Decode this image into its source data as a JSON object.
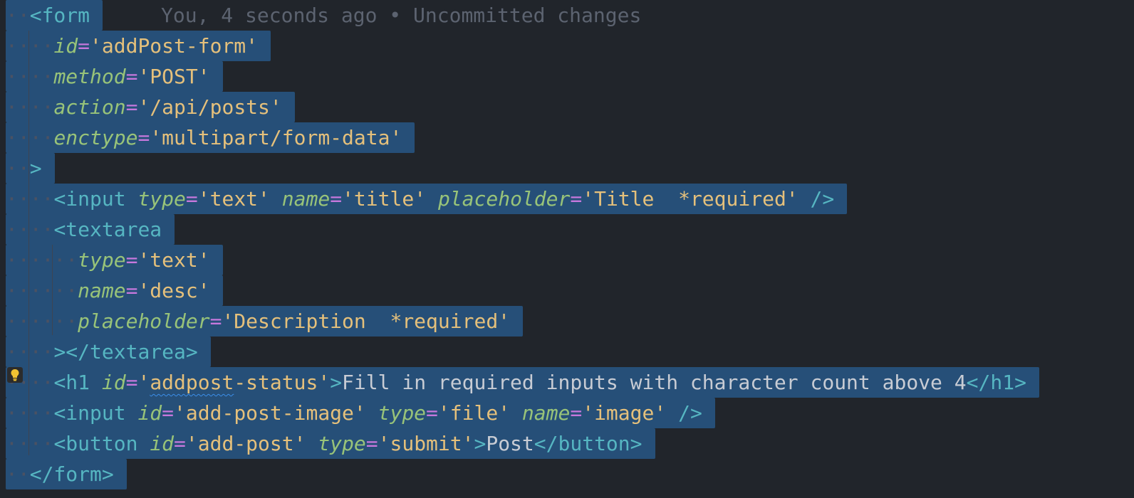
{
  "blame": "You, 4 seconds ago • Uncommitted changes",
  "lines": [
    {
      "tokens": [
        [
          "dots",
          "··"
        ],
        [
          "tag",
          "<form"
        ]
      ]
    },
    {
      "tokens": [
        [
          "dots",
          "····"
        ],
        [
          "attr",
          "id"
        ],
        [
          "eq",
          "="
        ],
        [
          "str",
          "'addPost-form'"
        ]
      ]
    },
    {
      "tokens": [
        [
          "dots",
          "····"
        ],
        [
          "attr",
          "method"
        ],
        [
          "eq",
          "="
        ],
        [
          "str",
          "'POST'"
        ]
      ]
    },
    {
      "tokens": [
        [
          "dots",
          "····"
        ],
        [
          "attr",
          "action"
        ],
        [
          "eq",
          "="
        ],
        [
          "str",
          "'/api/posts'"
        ]
      ]
    },
    {
      "tokens": [
        [
          "dots",
          "····"
        ],
        [
          "attr",
          "enctype"
        ],
        [
          "eq",
          "="
        ],
        [
          "str",
          "'multipart/form-data'"
        ]
      ]
    },
    {
      "tokens": [
        [
          "dots",
          "··"
        ],
        [
          "tag",
          ">"
        ]
      ]
    },
    {
      "tokens": [
        [
          "dots",
          "····"
        ],
        [
          "tag",
          "<input"
        ],
        [
          "txt",
          " "
        ],
        [
          "attr",
          "type"
        ],
        [
          "eq",
          "="
        ],
        [
          "str",
          "'text'"
        ],
        [
          "txt",
          " "
        ],
        [
          "attr",
          "name"
        ],
        [
          "eq",
          "="
        ],
        [
          "str",
          "'title'"
        ],
        [
          "txt",
          " "
        ],
        [
          "attr",
          "placeholder"
        ],
        [
          "eq",
          "="
        ],
        [
          "str",
          "'Title  *required'"
        ],
        [
          "txt",
          " "
        ],
        [
          "tag",
          "/>"
        ]
      ]
    },
    {
      "tokens": [
        [
          "dots",
          "····"
        ],
        [
          "tag",
          "<textarea"
        ]
      ]
    },
    {
      "tokens": [
        [
          "dots",
          "······"
        ],
        [
          "attr",
          "type"
        ],
        [
          "eq",
          "="
        ],
        [
          "str",
          "'text'"
        ]
      ]
    },
    {
      "tokens": [
        [
          "dots",
          "······"
        ],
        [
          "attr",
          "name"
        ],
        [
          "eq",
          "="
        ],
        [
          "str",
          "'desc'"
        ]
      ]
    },
    {
      "tokens": [
        [
          "dots",
          "······"
        ],
        [
          "attr",
          "placeholder"
        ],
        [
          "eq",
          "="
        ],
        [
          "str",
          "'Description  *required'"
        ]
      ]
    },
    {
      "tokens": [
        [
          "dots",
          "····"
        ],
        [
          "tag",
          "></textarea>"
        ]
      ]
    },
    {
      "tokens": [
        [
          "dots",
          "····"
        ],
        [
          "tag",
          "<h1"
        ],
        [
          "txt",
          " "
        ],
        [
          "attr",
          "id"
        ],
        [
          "eq",
          "="
        ],
        [
          "str",
          "'"
        ],
        [
          "strsq",
          "addpost"
        ],
        [
          "str",
          "-status'"
        ],
        [
          "tag",
          ">"
        ],
        [
          "txt",
          "Fill in required inputs with character count above 4"
        ],
        [
          "tag",
          "</h1>"
        ]
      ]
    },
    {
      "tokens": [
        [
          "dots",
          "····"
        ],
        [
          "tag",
          "<input"
        ],
        [
          "txt",
          " "
        ],
        [
          "attr",
          "id"
        ],
        [
          "eq",
          "="
        ],
        [
          "str",
          "'add-post-image'"
        ],
        [
          "txt",
          " "
        ],
        [
          "attr",
          "type"
        ],
        [
          "eq",
          "="
        ],
        [
          "str",
          "'file'"
        ],
        [
          "txt",
          " "
        ],
        [
          "attr",
          "name"
        ],
        [
          "eq",
          "="
        ],
        [
          "str",
          "'image'"
        ],
        [
          "txt",
          " "
        ],
        [
          "tag",
          "/>"
        ]
      ]
    },
    {
      "tokens": [
        [
          "dots",
          "····"
        ],
        [
          "tag",
          "<button"
        ],
        [
          "txt",
          " "
        ],
        [
          "attr",
          "id"
        ],
        [
          "eq",
          "="
        ],
        [
          "str",
          "'add-post'"
        ],
        [
          "txt",
          " "
        ],
        [
          "attr",
          "type"
        ],
        [
          "eq",
          "="
        ],
        [
          "str",
          "'submit'"
        ],
        [
          "tag",
          ">"
        ],
        [
          "txt",
          "Post"
        ],
        [
          "tag",
          "</button>"
        ]
      ]
    },
    {
      "tokens": [
        [
          "dots",
          "··"
        ],
        [
          "tag",
          "</form>"
        ]
      ]
    }
  ]
}
